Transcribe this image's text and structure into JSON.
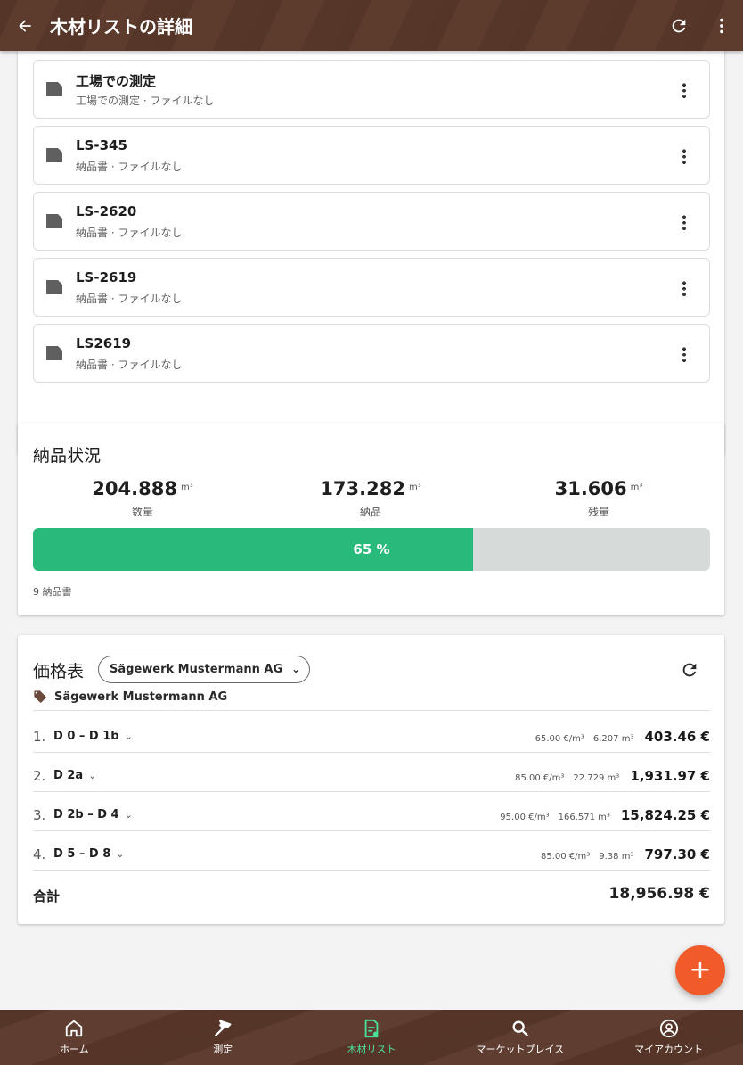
{
  "appbar": {
    "title": "木材リストの詳細"
  },
  "documents": [
    {
      "name": "工場での測定",
      "sub": "工場での測定 · ファイルなし"
    },
    {
      "name": "LS-345",
      "sub": "納品書 · ファイルなし"
    },
    {
      "name": "LS-2620",
      "sub": "納品書 · ファイルなし"
    },
    {
      "name": "LS-2619",
      "sub": "納品書 · ファイルなし"
    },
    {
      "name": "LS2619",
      "sub": "納品書 · ファイルなし"
    }
  ],
  "delivery": {
    "title": "納品状況",
    "stats": [
      {
        "value": "204.888",
        "unit": "m³",
        "label": "数量"
      },
      {
        "value": "173.282",
        "unit": "m³",
        "label": "納品"
      },
      {
        "value": "31.606",
        "unit": "m³",
        "label": "残量"
      }
    ],
    "progress_percent": 65,
    "progress_label": "65 %",
    "notes_count": "9 納品書"
  },
  "pricing": {
    "title": "価格表",
    "selected_supplier": "Sägewerk Mustermann AG",
    "supplier_line": "Sägewerk Mustermann AG",
    "rows": [
      {
        "num": "1.",
        "cls": "D 0 – D 1b",
        "price": "65.00 €/m³",
        "volume": "6.207 m³",
        "amount": "403.46 €"
      },
      {
        "num": "2.",
        "cls": "D 2a",
        "price": "85.00 €/m³",
        "volume": "22.729 m³",
        "amount": "1,931.97 €"
      },
      {
        "num": "3.",
        "cls": "D 2b – D 4",
        "price": "95.00 €/m³",
        "volume": "166.571 m³",
        "amount": "15,824.25 €"
      },
      {
        "num": "4.",
        "cls": "D 5 – D 8",
        "price": "85.00 €/m³",
        "volume": "9.38 m³",
        "amount": "797.30 €"
      }
    ],
    "total_label": "合計",
    "total_value": "18,956.98 €"
  },
  "fab": {
    "label": "+"
  },
  "nav": [
    {
      "label": "ホーム",
      "icon": "home-icon"
    },
    {
      "label": "測定",
      "icon": "hammer-icon"
    },
    {
      "label": "木材リスト",
      "icon": "wood-list-icon"
    },
    {
      "label": "マーケットプレイス",
      "icon": "search-icon"
    },
    {
      "label": "マイアカウント",
      "icon": "account-icon"
    }
  ],
  "colors": {
    "brand_brown": "#5a382a",
    "progress_green": "#28ba7a",
    "fab_orange": "#f15a29",
    "nav_active": "#4be09a"
  }
}
